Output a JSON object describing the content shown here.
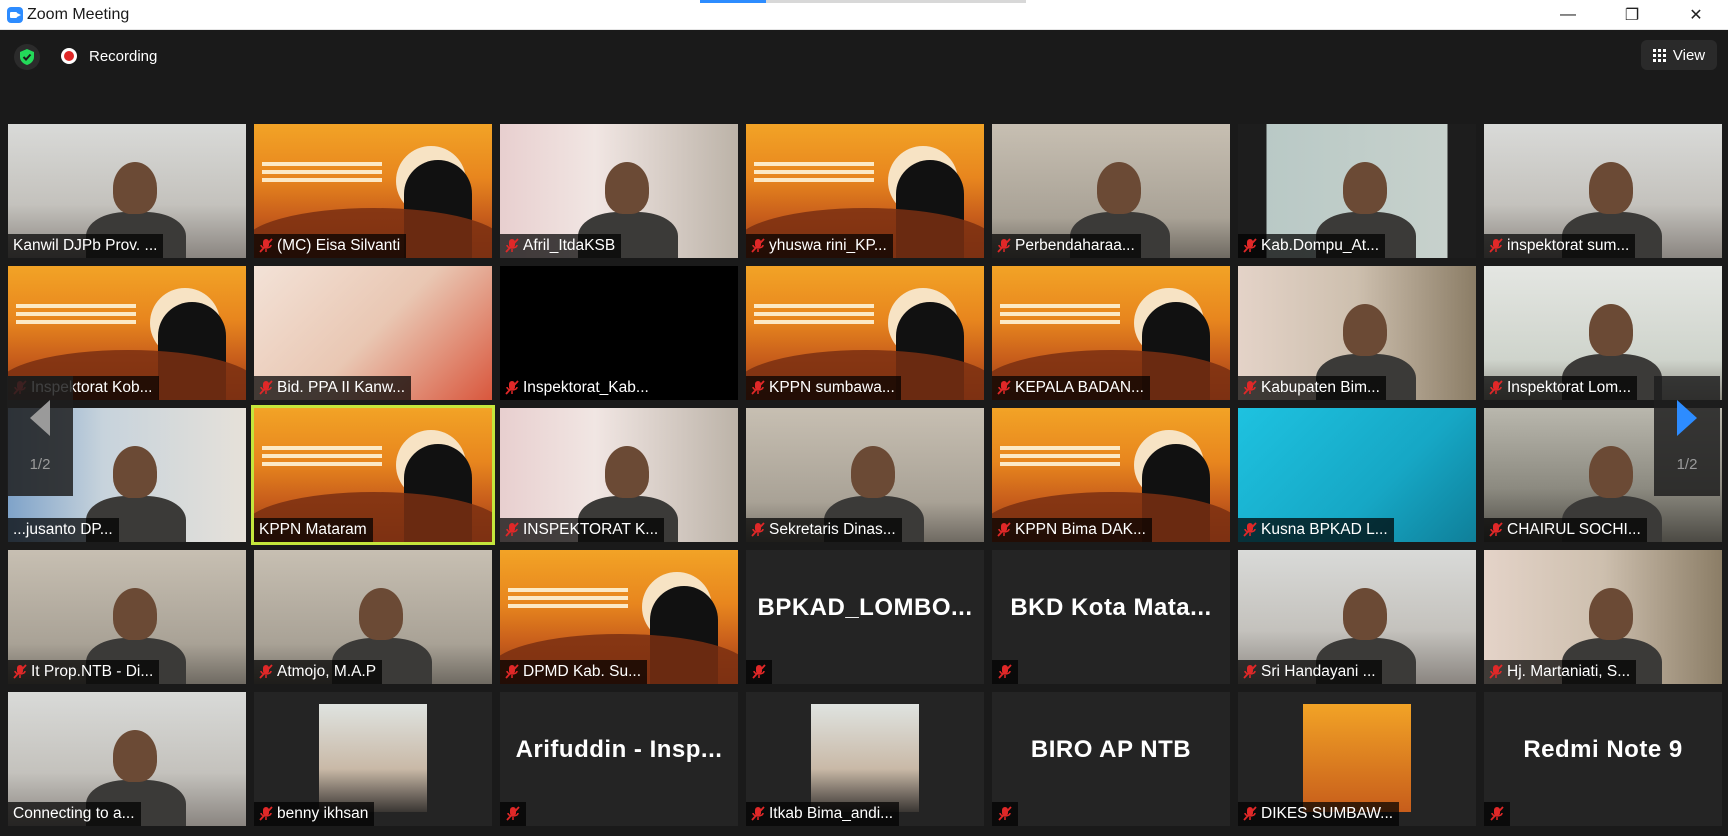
{
  "window": {
    "title": "Zoom Meeting",
    "minimize": "—",
    "restore": "❐",
    "close": "✕"
  },
  "topbar": {
    "recording_label": "Recording",
    "view_label": "View"
  },
  "nav": {
    "page_left": "1/2",
    "page_right": "1/2"
  },
  "tiles": [
    {
      "name": "Kanwil DJPb Prov. ...",
      "muted": false
    },
    {
      "name": "(MC) Eisa Silvanti",
      "muted": true
    },
    {
      "name": "Afril_ItdaKSB",
      "muted": true
    },
    {
      "name": "yhuswa rini_KP...",
      "muted": true
    },
    {
      "name": "Perbendaharaa...",
      "muted": true
    },
    {
      "name": "Kab.Dompu_At...",
      "muted": true
    },
    {
      "name": "inspektorat sum...",
      "muted": true
    },
    {
      "name": "Inspektorat Kob...",
      "muted": true
    },
    {
      "name": "Bid. PPA II Kanw...",
      "muted": true
    },
    {
      "name": "Inspektorat_Kab...",
      "muted": true
    },
    {
      "name": "KPPN sumbawa...",
      "muted": true
    },
    {
      "name": "KEPALA BADAN...",
      "muted": true
    },
    {
      "name": "Kabupaten Bim...",
      "muted": true
    },
    {
      "name": "Inspektorat Lom...",
      "muted": true
    },
    {
      "name": "...jusanto DP...",
      "muted": false
    },
    {
      "name": "KPPN Mataram",
      "muted": false
    },
    {
      "name": "INSPEKTORAT K...",
      "muted": true
    },
    {
      "name": "Sekretaris Dinas...",
      "muted": true
    },
    {
      "name": "KPPN Bima DAK...",
      "muted": true
    },
    {
      "name": "Kusna BPKAD L...",
      "muted": true
    },
    {
      "name": "CHAIRUL SOCHI...",
      "muted": true
    },
    {
      "name": "It Prop.NTB - Di...",
      "muted": true
    },
    {
      "name": "Atmojo, M.A.P",
      "muted": true
    },
    {
      "name": "DPMD Kab. Su...",
      "muted": true
    },
    {
      "name": "",
      "muted": true,
      "big": "BPKAD_LOMBO..."
    },
    {
      "name": "",
      "muted": true,
      "big": "BKD Kota Mata..."
    },
    {
      "name": "Sri Handayani ...",
      "muted": true
    },
    {
      "name": "Hj. Martaniati, S...",
      "muted": true
    },
    {
      "name": "Connecting to a...",
      "muted": false
    },
    {
      "name": "benny ikhsan",
      "muted": true
    },
    {
      "name": "",
      "muted": true,
      "big": "Arifuddin - Insp..."
    },
    {
      "name": "Itkab Bima_andi...",
      "muted": true
    },
    {
      "name": "",
      "muted": true,
      "big": "BIRO AP NTB"
    },
    {
      "name": "DIKES SUMBAW...",
      "muted": true
    },
    {
      "name": "",
      "muted": true,
      "big": "Redmi Note 9"
    }
  ],
  "colors": {
    "accent": "#2d8cff",
    "active_speaker": "#c4e63c",
    "muted_mic": "#e02828"
  },
  "icons": {
    "security": "shield-check-icon",
    "recording": "record-dot-icon",
    "view": "grid-icon",
    "mic": "mic-muted-icon"
  }
}
